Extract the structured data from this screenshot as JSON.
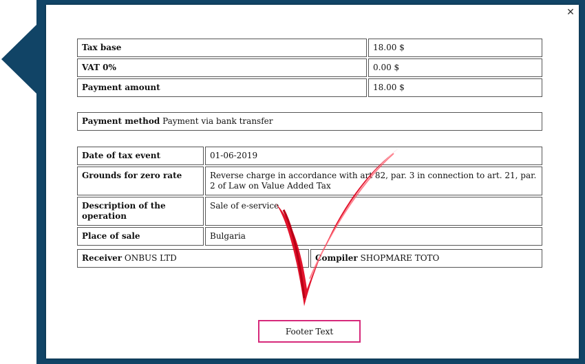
{
  "invoice": {
    "totals": [
      {
        "label": "Tax base",
        "value": "18.00 $"
      },
      {
        "label": "VAT 0%",
        "value": "0.00 $"
      },
      {
        "label": "Payment amount",
        "value": "18.00 $"
      }
    ],
    "payment": {
      "label": "Payment method",
      "value": "Payment via bank transfer"
    },
    "details": [
      {
        "label": "Date of tax event",
        "value": "01-06-2019"
      },
      {
        "label": "Grounds for zero rate",
        "value": "Reverse charge in accordance with art 82, par. 3 in connection to art. 21, par. 2 of Law on Value Added Tax"
      },
      {
        "label": "Description of the operation",
        "value": "Sale of e-service"
      },
      {
        "label": "Place of sale",
        "value": "Bulgaria"
      }
    ],
    "parties": {
      "receiver_label": "Receiver",
      "receiver_value": "ONBUS LTD",
      "compiler_label": "Compiler",
      "compiler_value": "SHOPMARE TOTO"
    },
    "footer_text": "Footer Text"
  },
  "colors": {
    "frame": "#114466",
    "checkmark": "#e0001b",
    "footer_border": "#d6287a"
  },
  "icons": {
    "close": "close-icon",
    "pointer": "arrow-pointer-icon",
    "check": "checkmark-icon"
  }
}
